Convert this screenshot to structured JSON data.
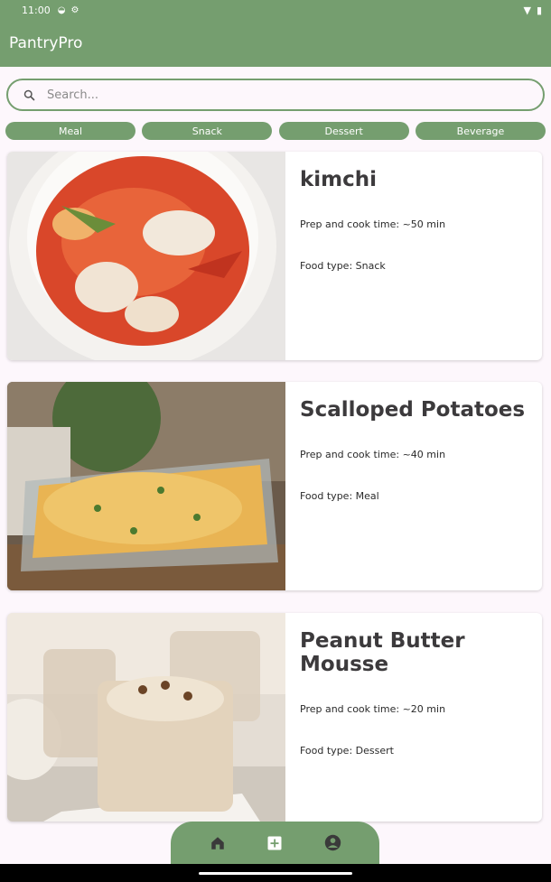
{
  "status_bar": {
    "time": "11:00"
  },
  "app_bar": {
    "title": "PantryPro"
  },
  "search": {
    "placeholder": "Search..."
  },
  "filters": [
    "Meal",
    "Snack",
    "Dessert",
    "Beverage"
  ],
  "recipes": [
    {
      "name": "kimchi",
      "prep": "Prep and cook time: ~50 min",
      "type": "Food type: Snack"
    },
    {
      "name": "Scalloped Potatoes",
      "prep": "Prep and cook time: ~40 min",
      "type": "Food type: Meal"
    },
    {
      "name": "Peanut Butter Mousse",
      "prep": "Prep and cook time: ~20 min",
      "type": "Food type: Dessert"
    }
  ],
  "nav": {
    "items": [
      "home-icon",
      "add-icon",
      "profile-icon"
    ]
  },
  "colors": {
    "primary": "#759e6f",
    "background": "#fdf7fc"
  }
}
